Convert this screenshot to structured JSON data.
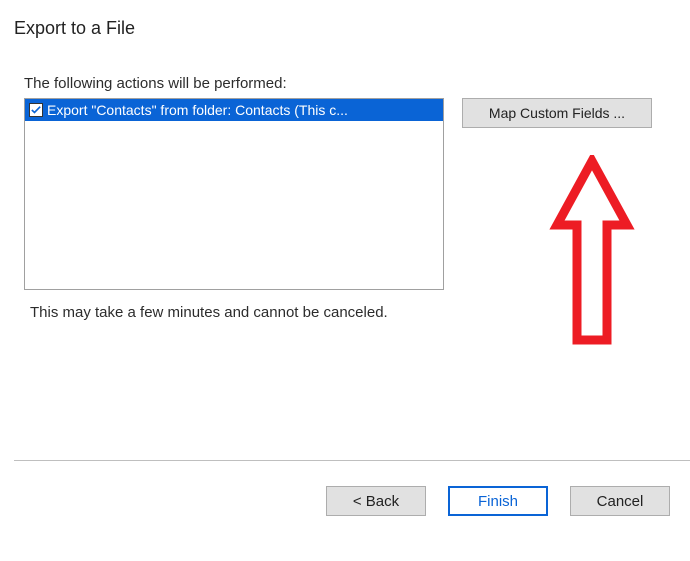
{
  "dialog": {
    "title": "Export to a File",
    "instruction": "The following actions will be performed:",
    "note": "This may take a few minutes and cannot be canceled."
  },
  "actions": {
    "item_label": "Export \"Contacts\" from folder: Contacts (This c...",
    "checked": true
  },
  "buttons": {
    "map_custom_fields": "Map Custom Fields ...",
    "back": "< Back",
    "finish": "Finish",
    "cancel": "Cancel"
  },
  "annotation": {
    "arrow_color": "#ed1c24"
  }
}
